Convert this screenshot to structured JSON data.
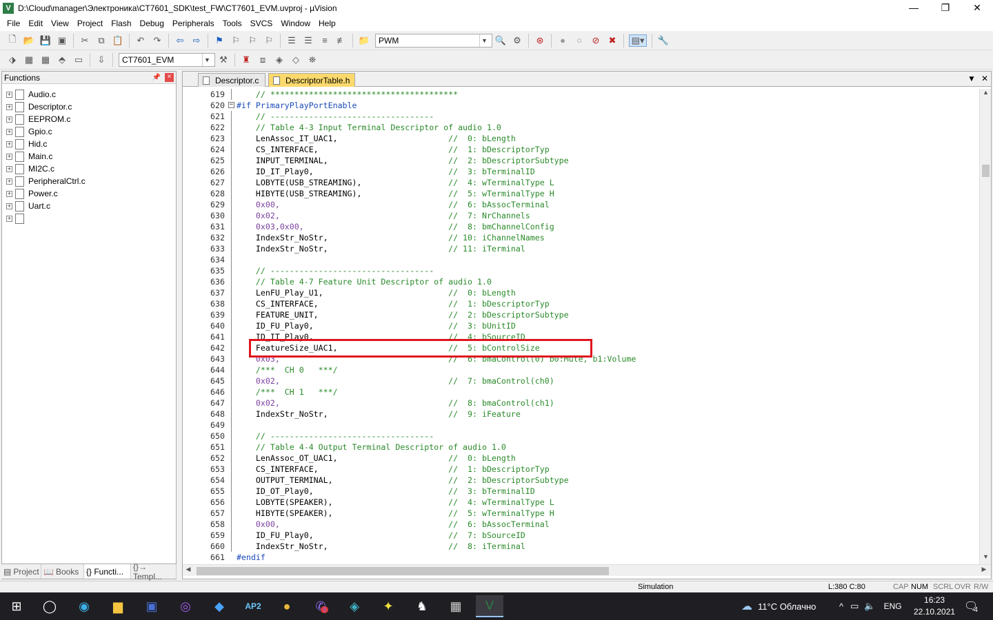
{
  "window": {
    "title": "D:\\Cloud\\manager\\Электроника\\CT7601_SDK\\test_FW\\CT7601_EVM.uvproj - µVision",
    "minimize": "—",
    "maximize": "❐",
    "close": "✕"
  },
  "menu": [
    "File",
    "Edit",
    "View",
    "Project",
    "Flash",
    "Debug",
    "Peripherals",
    "Tools",
    "SVCS",
    "Window",
    "Help"
  ],
  "toolbar1": {
    "find_combo": "PWM"
  },
  "toolbar2": {
    "target_combo": "CT7601_EVM"
  },
  "functions_panel": {
    "title": "Functions",
    "pin": "ᵖ",
    "close": "×",
    "files": [
      "Audio.c",
      "Descriptor.c",
      "EEPROM.c",
      "Gpio.c",
      "Hid.c",
      "Main.c",
      "MI2C.c",
      "PeripheralCtrl.c",
      "Power.c",
      "Uart.c"
    ],
    "bottom_tabs": [
      "Project",
      "Books",
      "{} Functi...",
      "{}→ Templ..."
    ]
  },
  "editor": {
    "tabs": [
      "Descriptor.c",
      "DescriptorTable.h"
    ],
    "active_tab": 1,
    "tab_menu": "▼",
    "tab_close": "✕",
    "lines": [
      {
        "n": "619",
        "t": "    // ***************************************",
        "k": "c"
      },
      {
        "n": "620",
        "t": "#if PrimaryPlayPortEnable",
        "k": "p",
        "fold": "minus"
      },
      {
        "n": "621",
        "t": "    // ----------------------------------",
        "k": "c"
      },
      {
        "n": "622",
        "t": "    // Table 4-3 Input Terminal Descriptor of audio 1.0",
        "k": "c"
      },
      {
        "n": "623",
        "code": "    LenAssoc_IT_UAC1,",
        "cm": "//  0: bLength"
      },
      {
        "n": "624",
        "code": "    CS_INTERFACE,",
        "cm": "//  1: bDescriptorTyp"
      },
      {
        "n": "625",
        "code": "    INPUT_TERMINAL,",
        "cm": "//  2: bDescriptorSubtype"
      },
      {
        "n": "626",
        "code": "    ID_IT_Play0,",
        "cm": "//  3: bTerminalID"
      },
      {
        "n": "627",
        "code": "    LOBYTE(USB_STREAMING),",
        "cm": "//  4: wTerminalType L"
      },
      {
        "n": "628",
        "code": "    HIBYTE(USB_STREAMING),",
        "cm": "//  5: wTerminalType H"
      },
      {
        "n": "629",
        "code": "    0x00,",
        "cm": "//  6: bAssocTerminal",
        "num": true
      },
      {
        "n": "630",
        "code": "    0x02,",
        "cm": "//  7: NrChannels",
        "num": true
      },
      {
        "n": "631",
        "code": "    0x03,0x00,",
        "cm": "//  8: bmChannelConfig",
        "num": true
      },
      {
        "n": "632",
        "code": "    IndexStr_NoStr,",
        "cm": "// 10: iChannelNames"
      },
      {
        "n": "633",
        "code": "    IndexStr_NoStr,",
        "cm": "// 11: iTerminal"
      },
      {
        "n": "634",
        "t": "",
        "k": ""
      },
      {
        "n": "635",
        "t": "    // ----------------------------------",
        "k": "c"
      },
      {
        "n": "636",
        "t": "    // Table 4-7 Feature Unit Descriptor of audio 1.0",
        "k": "c"
      },
      {
        "n": "637",
        "code": "    LenFU_Play_U1,",
        "cm": "//  0: bLength"
      },
      {
        "n": "638",
        "code": "    CS_INTERFACE,",
        "cm": "//  1: bDescriptorTyp"
      },
      {
        "n": "639",
        "code": "    FEATURE_UNIT,",
        "cm": "//  2: bDescriptorSubtype"
      },
      {
        "n": "640",
        "code": "    ID_FU_Play0,",
        "cm": "//  3: bUnitID"
      },
      {
        "n": "641",
        "code": "    ID_IT_Play0,",
        "cm": "//  4: bSourceID"
      },
      {
        "n": "642",
        "code": "    FeatureSize_UAC1,",
        "cm": "//  5: bControlSize"
      },
      {
        "n": "643",
        "code": "    0x03,",
        "cm": "//  6: bmaControl(0) b0:Mute, b1:Volume",
        "num": true
      },
      {
        "n": "644",
        "t": "    /***  CH 0   ***/",
        "k": "c"
      },
      {
        "n": "645",
        "code": "    0x02,",
        "cm": "//  7: bmaControl(ch0)",
        "num": true
      },
      {
        "n": "646",
        "t": "    /***  CH 1   ***/",
        "k": "c"
      },
      {
        "n": "647",
        "code": "    0x02,",
        "cm": "//  8: bmaControl(ch1)",
        "num": true
      },
      {
        "n": "648",
        "code": "    IndexStr_NoStr,",
        "cm": "//  9: iFeature"
      },
      {
        "n": "649",
        "t": "",
        "k": ""
      },
      {
        "n": "650",
        "t": "    // ----------------------------------",
        "k": "c"
      },
      {
        "n": "651",
        "t": "    // Table 4-4 Output Terminal Descriptor of audio 1.0",
        "k": "c"
      },
      {
        "n": "652",
        "code": "    LenAssoc_OT_UAC1,",
        "cm": "//  0: bLength"
      },
      {
        "n": "653",
        "code": "    CS_INTERFACE,",
        "cm": "//  1: bDescriptorTyp"
      },
      {
        "n": "654",
        "code": "    OUTPUT_TERMINAL,",
        "cm": "//  2: bDescriptorSubtype"
      },
      {
        "n": "655",
        "code": "    ID_OT_Play0,",
        "cm": "//  3: bTerminalID"
      },
      {
        "n": "656",
        "code": "    LOBYTE(SPEAKER),",
        "cm": "//  4: wTerminalType L"
      },
      {
        "n": "657",
        "code": "    HIBYTE(SPEAKER),",
        "cm": "//  5: wTerminalType H"
      },
      {
        "n": "658",
        "code": "    0x00,",
        "cm": "//  6: bAssocTerminal",
        "num": true
      },
      {
        "n": "659",
        "code": "    ID_FU_Play0,",
        "cm": "//  7: bSourceID"
      },
      {
        "n": "660",
        "code": "    IndexStr_NoStr,",
        "cm": "//  8: iTerminal"
      },
      {
        "n": "661",
        "t": "#endif",
        "k": "p",
        "fold": "end"
      }
    ]
  },
  "statusbar": {
    "mode": "Simulation",
    "position": "L:380 C:80",
    "caps": "CAP",
    "num": "NUM",
    "scrl": "SCRL",
    "ovr": "OVR",
    "rw": "R/W"
  },
  "taskbar": {
    "weather": "11°C  Облачно",
    "lang": "ENG",
    "time": "16:23",
    "date": "22.10.2021",
    "notif_count": "4",
    "badge_viber": "9",
    "ap2_label": "AP2"
  },
  "colors": {
    "highlight": "#e0141e",
    "active_tab": "#fbd96d",
    "comment": "#2a8a2a",
    "number": "#7b3fa0",
    "preproc": "#1a4ab8"
  }
}
